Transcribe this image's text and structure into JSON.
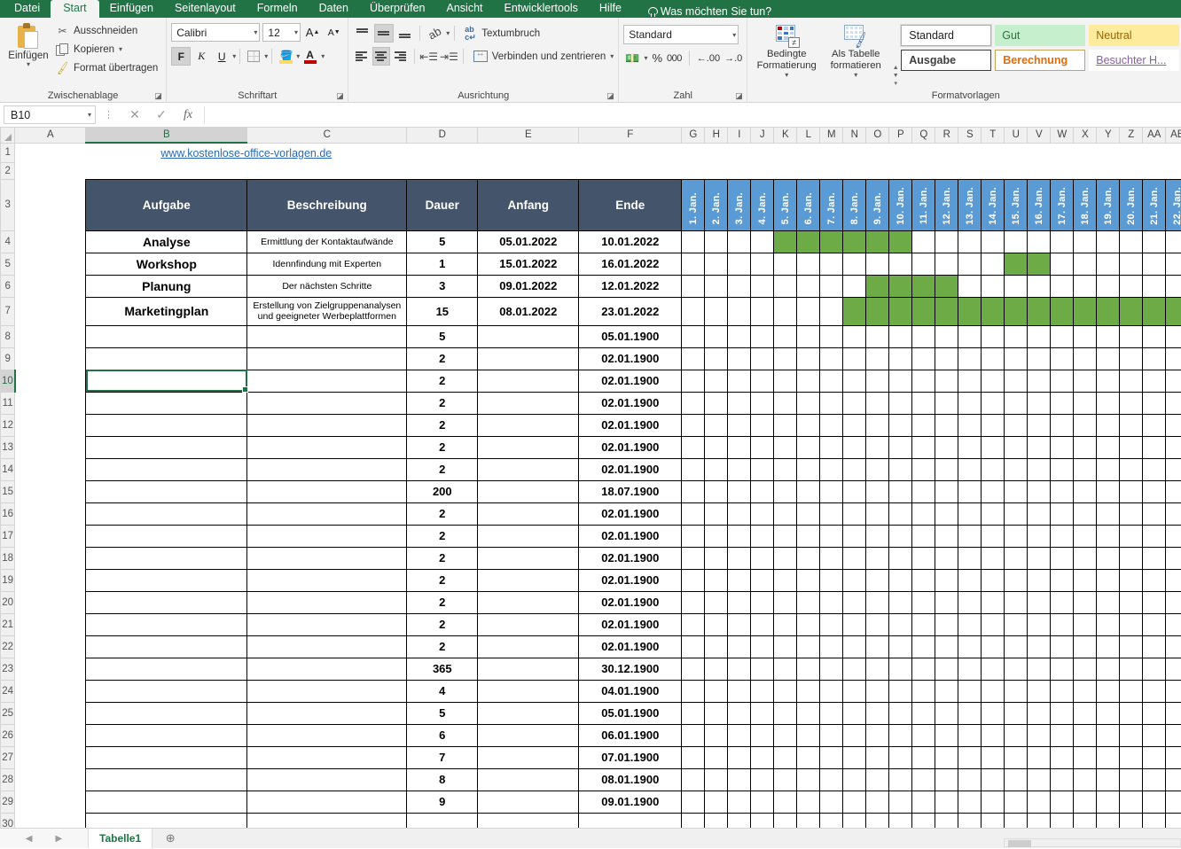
{
  "ribbon": {
    "tabs": [
      {
        "label": "Datei",
        "active": false
      },
      {
        "label": "Start",
        "active": true
      },
      {
        "label": "Einfügen",
        "active": false
      },
      {
        "label": "Seitenlayout",
        "active": false
      },
      {
        "label": "Formeln",
        "active": false
      },
      {
        "label": "Daten",
        "active": false
      },
      {
        "label": "Überprüfen",
        "active": false
      },
      {
        "label": "Ansicht",
        "active": false
      },
      {
        "label": "Entwicklertools",
        "active": false
      },
      {
        "label": "Hilfe",
        "active": false
      }
    ],
    "tell_me": "Was möchten Sie tun?",
    "groups": {
      "clipboard": {
        "label": "Zwischenablage",
        "paste": "Einfügen",
        "cut": "Ausschneiden",
        "copy": "Kopieren",
        "format_painter": "Format übertragen"
      },
      "font": {
        "label": "Schriftart",
        "font_name": "Calibri",
        "font_size": "12",
        "bold": "F",
        "italic": "K",
        "underline": "U",
        "grow": "A",
        "shrink": "A"
      },
      "alignment": {
        "label": "Ausrichtung",
        "wrap_text": "Textumbruch",
        "merge_center": "Verbinden und zentrieren"
      },
      "number": {
        "label": "Zahl",
        "format": "Standard",
        "percent": "%",
        "thousands": "000"
      },
      "styles": {
        "label": "Formatvorlagen",
        "conditional_formatting": "Bedingte Formatierung",
        "format_as_table": "Als Tabelle formatieren",
        "cells": [
          {
            "label": "Standard",
            "kind": "standard"
          },
          {
            "label": "Gut",
            "kind": "gut"
          },
          {
            "label": "Neutral",
            "kind": "neutral"
          },
          {
            "label": "Ausgabe",
            "kind": "ausgabe"
          },
          {
            "label": "Berechnung",
            "kind": "berechnung"
          },
          {
            "label": "Besuchter H...",
            "kind": "link"
          }
        ]
      }
    }
  },
  "formula_bar": {
    "name_box": "B10",
    "cancel": "✕",
    "confirm": "✓",
    "fx": "fx",
    "value": ""
  },
  "sheet": {
    "column_headers": [
      "A",
      "B",
      "C",
      "D",
      "E",
      "F",
      "G",
      "H",
      "I",
      "J",
      "K",
      "L",
      "M",
      "N",
      "O",
      "P",
      "Q",
      "R",
      "S",
      "T",
      "U",
      "V",
      "W",
      "X",
      "Y",
      "Z",
      "AA",
      "AB"
    ],
    "selected_column": "B",
    "selected_row": 10,
    "selected_cell": "B10",
    "row_numbers": [
      1,
      2,
      3,
      4,
      5,
      6,
      7,
      8,
      9,
      10,
      11,
      12,
      13,
      14,
      15,
      16,
      17,
      18,
      19,
      20,
      21,
      22,
      23,
      24,
      25,
      26,
      27,
      28,
      29,
      30
    ],
    "link": "www.kostenlose-office-vorlagen.de",
    "table_headers": [
      "Aufgabe",
      "Beschreibung",
      "Dauer",
      "Anfang",
      "Ende"
    ],
    "date_headers": [
      "1. Jan.",
      "2. Jan.",
      "3. Jan.",
      "4. Jan.",
      "5. Jan.",
      "6. Jan.",
      "7. Jan.",
      "8. Jan.",
      "9. Jan.",
      "10. Jan.",
      "11. Jan.",
      "12. Jan.",
      "13. Jan.",
      "14. Jan.",
      "15. Jan.",
      "16. Jan.",
      "17. Jan.",
      "18. Jan.",
      "19. Jan.",
      "20. Jan.",
      "21. Jan.",
      "22. Jan."
    ],
    "rows": [
      {
        "row": 4,
        "aufgabe": "Analyse",
        "beschreibung": "Ermittlung der Kontaktaufwände",
        "dauer": "5",
        "anfang": "05.01.2022",
        "ende": "10.01.2022",
        "bar_start": 5,
        "bar_end": 10
      },
      {
        "row": 5,
        "aufgabe": "Workshop",
        "beschreibung": "Idennfindung mit Experten",
        "dauer": "1",
        "anfang": "15.01.2022",
        "ende": "16.01.2022",
        "bar_start": 15,
        "bar_end": 16
      },
      {
        "row": 6,
        "aufgabe": "Planung",
        "beschreibung": "Der nächsten Schritte",
        "dauer": "3",
        "anfang": "09.01.2022",
        "ende": "12.01.2022",
        "bar_start": 9,
        "bar_end": 12
      },
      {
        "row": 7,
        "aufgabe": "Marketingplan",
        "beschreibung": "Erstellung von Zielgruppenanalysen und geeigneter Werbeplattformen",
        "dauer": "15",
        "anfang": "08.01.2022",
        "ende": "23.01.2022",
        "bar_start": 8,
        "bar_end": 22
      },
      {
        "row": 8,
        "aufgabe": "",
        "beschreibung": "",
        "dauer": "5",
        "anfang": "",
        "ende": "05.01.1900",
        "bar_start": 0,
        "bar_end": 0
      },
      {
        "row": 9,
        "aufgabe": "",
        "beschreibung": "",
        "dauer": "2",
        "anfang": "",
        "ende": "02.01.1900",
        "bar_start": 0,
        "bar_end": 0
      },
      {
        "row": 10,
        "aufgabe": "",
        "beschreibung": "",
        "dauer": "2",
        "anfang": "",
        "ende": "02.01.1900",
        "bar_start": 0,
        "bar_end": 0
      },
      {
        "row": 11,
        "aufgabe": "",
        "beschreibung": "",
        "dauer": "2",
        "anfang": "",
        "ende": "02.01.1900",
        "bar_start": 0,
        "bar_end": 0
      },
      {
        "row": 12,
        "aufgabe": "",
        "beschreibung": "",
        "dauer": "2",
        "anfang": "",
        "ende": "02.01.1900",
        "bar_start": 0,
        "bar_end": 0
      },
      {
        "row": 13,
        "aufgabe": "",
        "beschreibung": "",
        "dauer": "2",
        "anfang": "",
        "ende": "02.01.1900",
        "bar_start": 0,
        "bar_end": 0
      },
      {
        "row": 14,
        "aufgabe": "",
        "beschreibung": "",
        "dauer": "2",
        "anfang": "",
        "ende": "02.01.1900",
        "bar_start": 0,
        "bar_end": 0
      },
      {
        "row": 15,
        "aufgabe": "",
        "beschreibung": "",
        "dauer": "200",
        "anfang": "",
        "ende": "18.07.1900",
        "bar_start": 0,
        "bar_end": 0
      },
      {
        "row": 16,
        "aufgabe": "",
        "beschreibung": "",
        "dauer": "2",
        "anfang": "",
        "ende": "02.01.1900",
        "bar_start": 0,
        "bar_end": 0
      },
      {
        "row": 17,
        "aufgabe": "",
        "beschreibung": "",
        "dauer": "2",
        "anfang": "",
        "ende": "02.01.1900",
        "bar_start": 0,
        "bar_end": 0
      },
      {
        "row": 18,
        "aufgabe": "",
        "beschreibung": "",
        "dauer": "2",
        "anfang": "",
        "ende": "02.01.1900",
        "bar_start": 0,
        "bar_end": 0
      },
      {
        "row": 19,
        "aufgabe": "",
        "beschreibung": "",
        "dauer": "2",
        "anfang": "",
        "ende": "02.01.1900",
        "bar_start": 0,
        "bar_end": 0
      },
      {
        "row": 20,
        "aufgabe": "",
        "beschreibung": "",
        "dauer": "2",
        "anfang": "",
        "ende": "02.01.1900",
        "bar_start": 0,
        "bar_end": 0
      },
      {
        "row": 21,
        "aufgabe": "",
        "beschreibung": "",
        "dauer": "2",
        "anfang": "",
        "ende": "02.01.1900",
        "bar_start": 0,
        "bar_end": 0
      },
      {
        "row": 22,
        "aufgabe": "",
        "beschreibung": "",
        "dauer": "2",
        "anfang": "",
        "ende": "02.01.1900",
        "bar_start": 0,
        "bar_end": 0
      },
      {
        "row": 23,
        "aufgabe": "",
        "beschreibung": "",
        "dauer": "365",
        "anfang": "",
        "ende": "30.12.1900",
        "bar_start": 0,
        "bar_end": 0
      },
      {
        "row": 24,
        "aufgabe": "",
        "beschreibung": "",
        "dauer": "4",
        "anfang": "",
        "ende": "04.01.1900",
        "bar_start": 0,
        "bar_end": 0
      },
      {
        "row": 25,
        "aufgabe": "",
        "beschreibung": "",
        "dauer": "5",
        "anfang": "",
        "ende": "05.01.1900",
        "bar_start": 0,
        "bar_end": 0
      },
      {
        "row": 26,
        "aufgabe": "",
        "beschreibung": "",
        "dauer": "6",
        "anfang": "",
        "ende": "06.01.1900",
        "bar_start": 0,
        "bar_end": 0
      },
      {
        "row": 27,
        "aufgabe": "",
        "beschreibung": "",
        "dauer": "7",
        "anfang": "",
        "ende": "07.01.1900",
        "bar_start": 0,
        "bar_end": 0
      },
      {
        "row": 28,
        "aufgabe": "",
        "beschreibung": "",
        "dauer": "8",
        "anfang": "",
        "ende": "08.01.1900",
        "bar_start": 0,
        "bar_end": 0
      },
      {
        "row": 29,
        "aufgabe": "",
        "beschreibung": "",
        "dauer": "9",
        "anfang": "",
        "ende": "09.01.1900",
        "bar_start": 0,
        "bar_end": 0
      }
    ]
  },
  "tabbar": {
    "sheet_name": "Tabelle1",
    "add_sheet": "⊕",
    "prev": "◀",
    "next": "▶"
  },
  "colors": {
    "ribbon_green": "#217346",
    "table_header": "#44546a",
    "date_header": "#5b9bd5",
    "bar_green": "#6cab46",
    "link_blue": "#2b6bb5"
  }
}
